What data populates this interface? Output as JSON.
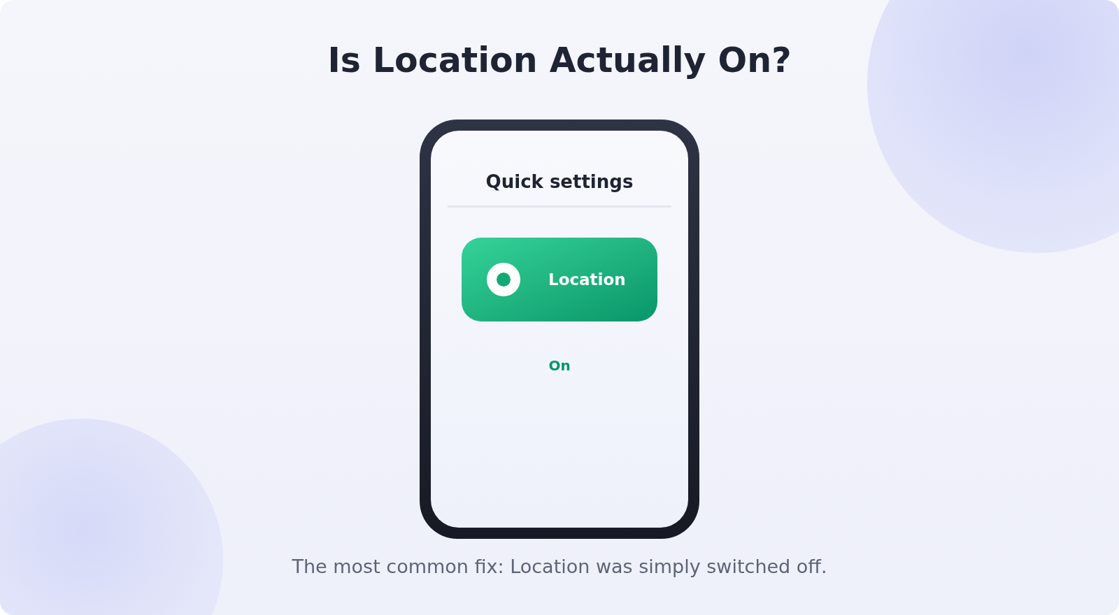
{
  "title": "Is Location Actually On?",
  "phone": {
    "header": "Quick settings",
    "tile": {
      "label": "Location",
      "on": true
    },
    "status": "On"
  },
  "caption": "The most common fix: Location was simply switched off."
}
